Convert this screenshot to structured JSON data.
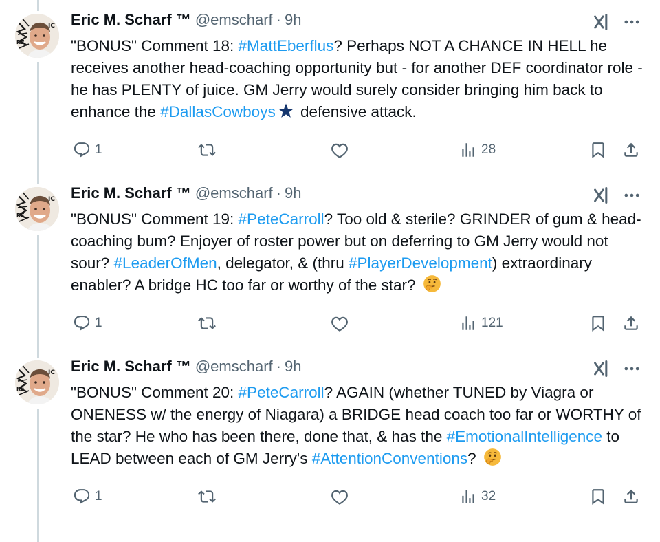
{
  "tweets": [
    {
      "author": {
        "name": "Eric M. Scharf ™",
        "handle": "@emscharf",
        "separator": "·",
        "time": "9h"
      },
      "segments": [
        {
          "type": "text",
          "value": "\"BONUS\" Comment 18: "
        },
        {
          "type": "tag",
          "value": "#MattEberflus"
        },
        {
          "type": "text",
          "value": "? Perhaps NOT A CHANCE IN HELL he receives another head-coaching opportunity but - for another DEF coordinator role - he has PLENTY of juice. GM Jerry would surely consider bringing him back to enhance the "
        },
        {
          "type": "tag",
          "value": "#DallasCowboys"
        },
        {
          "type": "emoji",
          "value": "star-icon"
        },
        {
          "type": "text",
          "value": " defensive attack."
        }
      ],
      "stats": {
        "replies": "1",
        "reposts": "",
        "likes": "",
        "views": "28"
      }
    },
    {
      "author": {
        "name": "Eric M. Scharf ™",
        "handle": "@emscharf",
        "separator": "·",
        "time": "9h"
      },
      "segments": [
        {
          "type": "text",
          "value": "\"BONUS\" Comment 19: "
        },
        {
          "type": "tag",
          "value": "#PeteCarroll"
        },
        {
          "type": "text",
          "value": "? Too old & sterile? GRINDER of gum & head-coaching bum? Enjoyer of roster power but on deferring to GM Jerry would not sour? "
        },
        {
          "type": "tag",
          "value": "#LeaderOfMen"
        },
        {
          "type": "text",
          "value": ", delegator, & (thru "
        },
        {
          "type": "tag",
          "value": "#PlayerDevelopment"
        },
        {
          "type": "text",
          "value": ") extraordinary enabler? A bridge HC too far or worthy of the star? "
        },
        {
          "type": "emoji",
          "value": "thinking-face-icon"
        }
      ],
      "stats": {
        "replies": "1",
        "reposts": "",
        "likes": "",
        "views": "121"
      }
    },
    {
      "author": {
        "name": "Eric M. Scharf ™",
        "handle": "@emscharf",
        "separator": "·",
        "time": "9h"
      },
      "segments": [
        {
          "type": "text",
          "value": "\"BONUS\" Comment 20: "
        },
        {
          "type": "tag",
          "value": "#PeteCarroll"
        },
        {
          "type": "text",
          "value": "? AGAIN (whether TUNED by Viagra or ONENESS w/ the energy of Niagara) a BRIDGE head coach too far or WORTHY of the star? He who has been there, done that, & has the "
        },
        {
          "type": "tag",
          "value": "#EmotionalIntelligence"
        },
        {
          "type": "text",
          "value": " to LEAD between each of GM Jerry's "
        },
        {
          "type": "tag",
          "value": "#AttentionConventions"
        },
        {
          "type": "text",
          "value": "? "
        },
        {
          "type": "emoji",
          "value": "thinking-face-icon"
        }
      ],
      "stats": {
        "replies": "1",
        "reposts": "",
        "likes": "",
        "views": "32"
      }
    }
  ],
  "colors": {
    "text": "#0f1419",
    "secondary": "#536471",
    "link": "#1d9bf0",
    "thread_line": "#cfd9de",
    "star": "#15366e",
    "emoji": "#f6b93b"
  }
}
